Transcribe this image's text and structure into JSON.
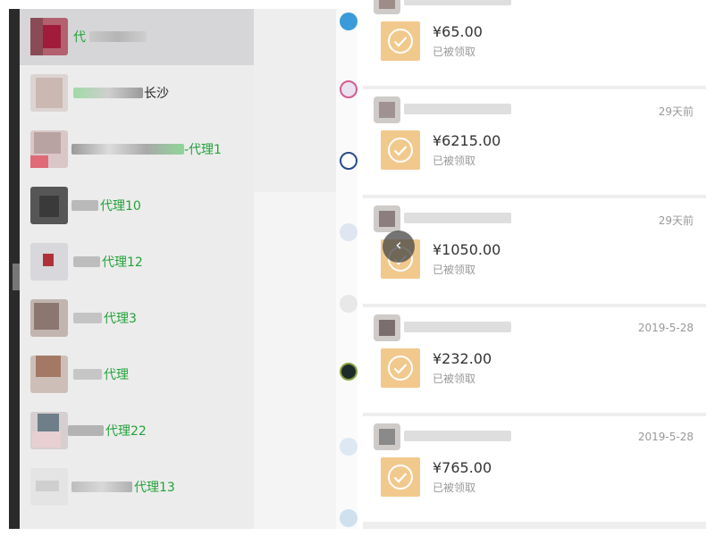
{
  "contacts": [
    {
      "prefix": "",
      "name": "代",
      "suffix": "",
      "selected": true
    },
    {
      "prefix": "",
      "name": "长沙",
      "suffix": "",
      "selected": false
    },
    {
      "prefix": "",
      "name": "-代理1",
      "suffix": "",
      "selected": false
    },
    {
      "prefix": "",
      "name": "代理10",
      "suffix": "",
      "selected": false
    },
    {
      "prefix": "",
      "name": "代理12",
      "suffix": "",
      "selected": false
    },
    {
      "prefix": "",
      "name": "代理3",
      "suffix": "",
      "selected": false
    },
    {
      "prefix": "",
      "name": "代理",
      "suffix": "",
      "selected": false
    },
    {
      "prefix": "",
      "name": "代理22",
      "suffix": "",
      "selected": false
    },
    {
      "prefix": "",
      "name": "代理13",
      "suffix": "",
      "selected": false
    }
  ],
  "records": [
    {
      "time": "",
      "amount": "¥65.00",
      "status": "已被领取"
    },
    {
      "time": "29天前",
      "amount": "¥6215.00",
      "status": "已被领取"
    },
    {
      "time": "29天前",
      "amount": "¥1050.00",
      "status": "已被领取"
    },
    {
      "time": "2019-5-28",
      "amount": "¥232.00",
      "status": "已被领取"
    },
    {
      "time": "2019-5-28",
      "amount": "¥765.00",
      "status": "已被领取"
    }
  ],
  "float_button": "‹",
  "colors": {
    "agent_green": "#23a23a",
    "packet_orange": "#f2c98d",
    "check_white": "#ffffff"
  }
}
